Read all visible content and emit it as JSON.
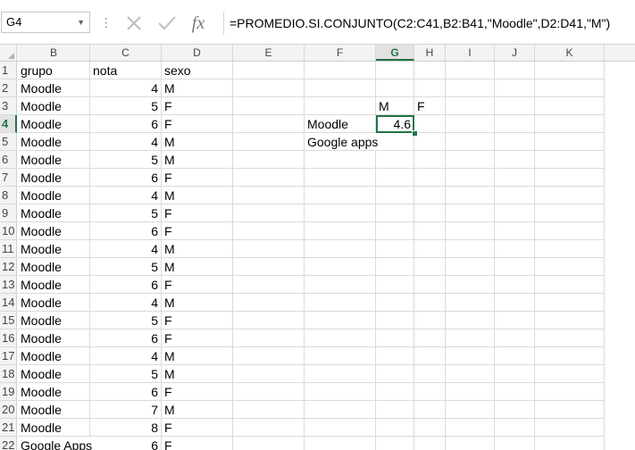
{
  "formula_bar": {
    "name_box": "G4",
    "formula": "=PROMEDIO.SI.CONJUNTO(C2:C41,B2:B41,\"Moodle\",D2:D41,\"M\")",
    "fx_label": "fx"
  },
  "columns": [
    {
      "label": "B",
      "active": false
    },
    {
      "label": "C",
      "active": false
    },
    {
      "label": "D",
      "active": false
    },
    {
      "label": "E",
      "active": false
    },
    {
      "label": "F",
      "active": false
    },
    {
      "label": "G",
      "active": true
    },
    {
      "label": "H",
      "active": false
    },
    {
      "label": "I",
      "active": false
    },
    {
      "label": "J",
      "active": false
    },
    {
      "label": "K",
      "active": false
    }
  ],
  "selected_cell": "G4",
  "rows": [
    {
      "num": "1",
      "cells": {
        "B": "grupo",
        "C": "nota",
        "D": "sexo"
      }
    },
    {
      "num": "2",
      "cells": {
        "B": "Moodle",
        "C": "4",
        "D": "M"
      }
    },
    {
      "num": "3",
      "cells": {
        "B": "Moodle",
        "C": "5",
        "D": "F",
        "G": "M",
        "H": "F"
      }
    },
    {
      "num": "4",
      "cells": {
        "B": "Moodle",
        "C": "6",
        "D": "F",
        "F": "Moodle",
        "G": "4.6"
      }
    },
    {
      "num": "5",
      "cells": {
        "B": "Moodle",
        "C": "4",
        "D": "M",
        "F": "Google apps"
      }
    },
    {
      "num": "6",
      "cells": {
        "B": "Moodle",
        "C": "5",
        "D": "M"
      }
    },
    {
      "num": "7",
      "cells": {
        "B": "Moodle",
        "C": "6",
        "D": "F"
      }
    },
    {
      "num": "8",
      "cells": {
        "B": "Moodle",
        "C": "4",
        "D": "M"
      }
    },
    {
      "num": "9",
      "cells": {
        "B": "Moodle",
        "C": "5",
        "D": "F"
      }
    },
    {
      "num": "10",
      "cells": {
        "B": "Moodle",
        "C": "6",
        "D": "F"
      }
    },
    {
      "num": "11",
      "cells": {
        "B": "Moodle",
        "C": "4",
        "D": "M"
      }
    },
    {
      "num": "12",
      "cells": {
        "B": "Moodle",
        "C": "5",
        "D": "M"
      }
    },
    {
      "num": "13",
      "cells": {
        "B": "Moodle",
        "C": "6",
        "D": "F"
      }
    },
    {
      "num": "14",
      "cells": {
        "B": "Moodle",
        "C": "4",
        "D": "M"
      }
    },
    {
      "num": "15",
      "cells": {
        "B": "Moodle",
        "C": "5",
        "D": "F"
      }
    },
    {
      "num": "16",
      "cells": {
        "B": "Moodle",
        "C": "6",
        "D": "F"
      }
    },
    {
      "num": "17",
      "cells": {
        "B": "Moodle",
        "C": "4",
        "D": "M"
      }
    },
    {
      "num": "18",
      "cells": {
        "B": "Moodle",
        "C": "5",
        "D": "M"
      }
    },
    {
      "num": "19",
      "cells": {
        "B": "Moodle",
        "C": "6",
        "D": "F"
      }
    },
    {
      "num": "20",
      "cells": {
        "B": "Moodle",
        "C": "7",
        "D": "M"
      }
    },
    {
      "num": "21",
      "cells": {
        "B": "Moodle",
        "C": "8",
        "D": "F"
      }
    },
    {
      "num": "22",
      "cells": {
        "B": "Google Apps",
        "C": "6",
        "D": "F"
      }
    }
  ],
  "accent_color": "#217346"
}
